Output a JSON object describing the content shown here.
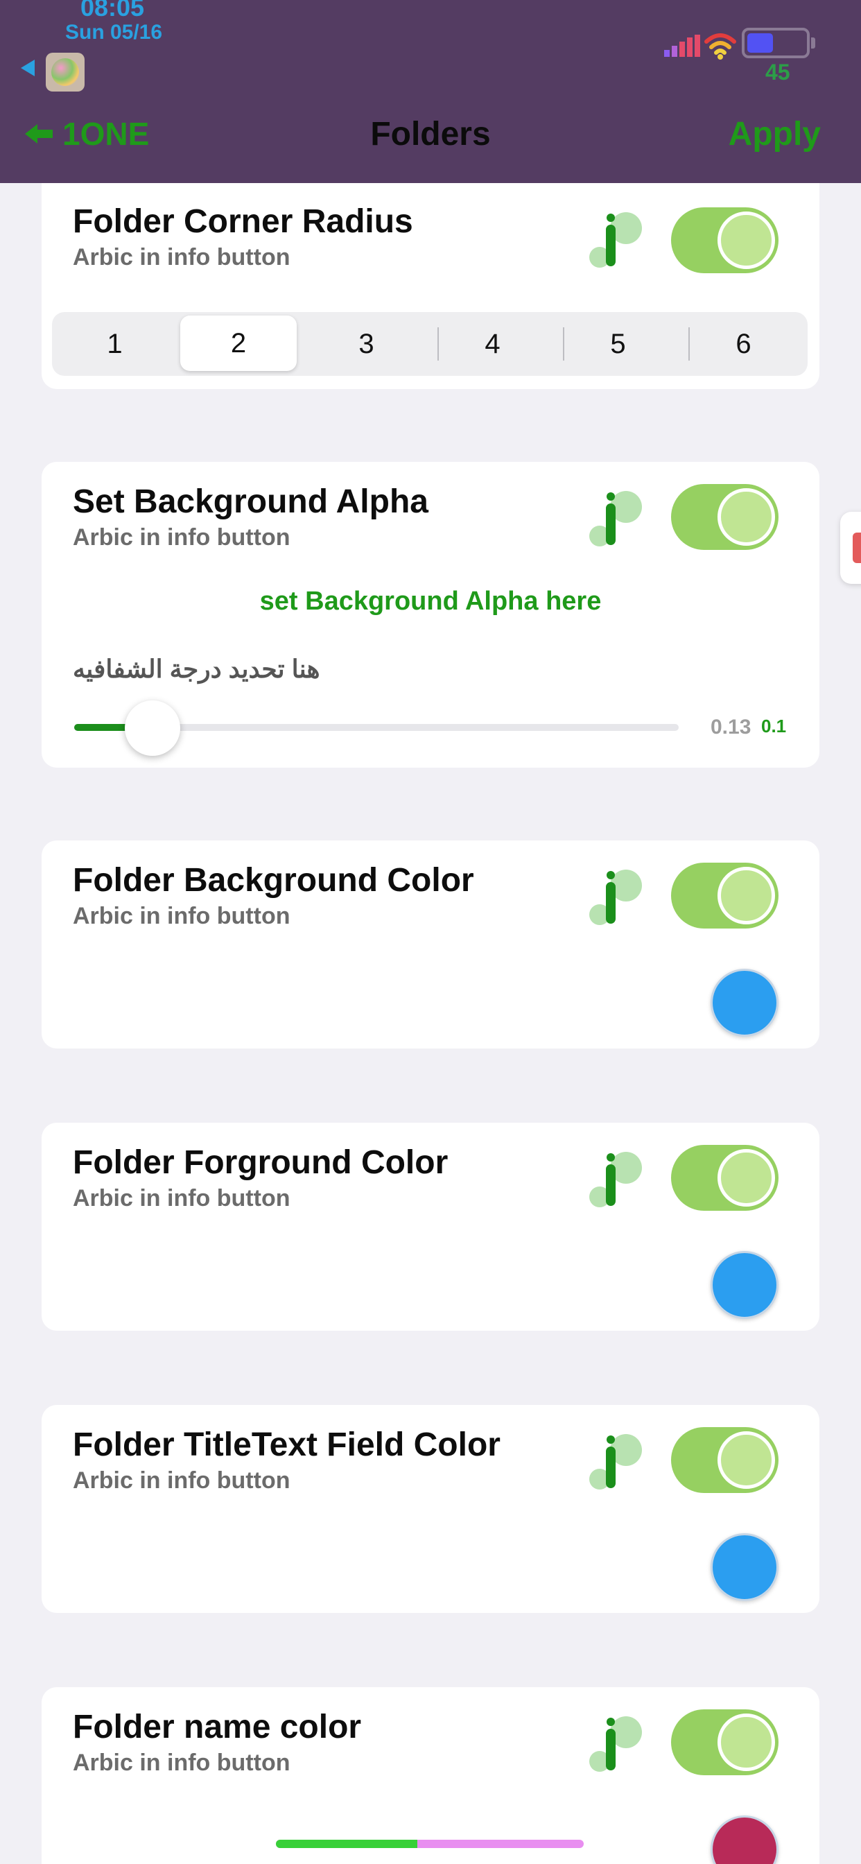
{
  "status_bar": {
    "time": "08:05",
    "date": "Sun 05/16",
    "battery_percent": "45",
    "battery_level": 0.45
  },
  "nav": {
    "back_label": "1ONE",
    "title": "Folders",
    "apply_label": "Apply"
  },
  "colors": {
    "header_bg": "#543c62",
    "accent_green": "#1f9a1a",
    "toggle_on": "#96d061",
    "color_well_blue": "#2b9ef0",
    "color_well_crimson": "#b82a58"
  },
  "cards": {
    "corner_radius": {
      "title": "Folder Corner Radius",
      "subtitle": "Arbic in info button",
      "toggle_on": true,
      "segments": [
        "1",
        "2",
        "3",
        "4",
        "5",
        "6"
      ],
      "selected_segment": "2"
    },
    "background_alpha": {
      "title": "Set Background Alpha",
      "subtitle": "Arbic in info button",
      "toggle_on": true,
      "link_text": "set Background Alpha here",
      "arabic_text": "هنا تحديد درجة الشفافيه",
      "slider_value": "0.13",
      "slider_step": "0.1",
      "slider_fraction": 0.13
    },
    "background_color": {
      "title": "Folder Background Color",
      "subtitle": "Arbic in info button",
      "toggle_on": true,
      "color": "#2b9ef0"
    },
    "foreground_color": {
      "title": "Folder Forground Color",
      "subtitle": "Arbic in info button",
      "toggle_on": true,
      "color": "#2b9ef0"
    },
    "title_text_field_color": {
      "title": "Folder TitleText Field Color",
      "subtitle": "Arbic in info button",
      "toggle_on": true,
      "color": "#2b9ef0"
    },
    "name_color": {
      "title": "Folder name color",
      "subtitle": "Arbic in info button",
      "toggle_on": true,
      "color": "#b82a58",
      "bar_fraction": 0.46
    }
  }
}
